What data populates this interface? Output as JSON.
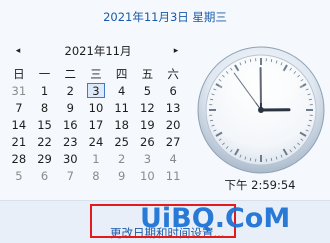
{
  "header": {
    "full_date": "2021年11月3日 星期三"
  },
  "calendar": {
    "month_title": "2021年11月",
    "prev_icon": "◂",
    "next_icon": "▸",
    "weekdays": [
      "日",
      "一",
      "二",
      "三",
      "四",
      "五",
      "六"
    ],
    "weeks": [
      [
        "31",
        "1",
        "2",
        "3",
        "4",
        "5",
        "6"
      ],
      [
        "7",
        "8",
        "9",
        "10",
        "11",
        "12",
        "13"
      ],
      [
        "14",
        "15",
        "16",
        "17",
        "18",
        "19",
        "20"
      ],
      [
        "21",
        "22",
        "23",
        "24",
        "25",
        "26",
        "27"
      ],
      [
        "28",
        "29",
        "30",
        "1",
        "2",
        "3",
        "4"
      ],
      [
        "5",
        "6",
        "7",
        "8",
        "9",
        "10",
        "11"
      ]
    ],
    "today": "3"
  },
  "clock": {
    "time_label": "下午 2:59:54"
  },
  "footer": {
    "settings_link": "更改日期和时间设置..."
  },
  "watermark": {
    "text": "UiBQ.CoM"
  },
  "colors": {
    "link": "#1a5aa8",
    "highlight_border": "#e21b1b",
    "watermark": "#1f74d6"
  }
}
